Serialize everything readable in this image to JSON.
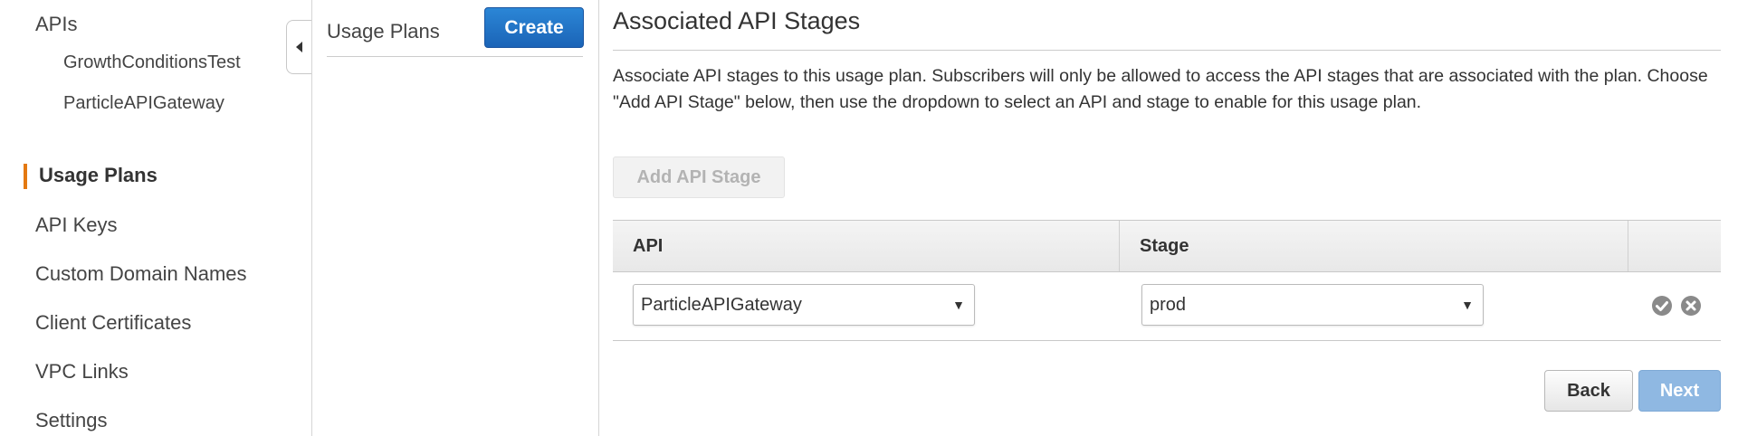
{
  "nav": {
    "apis": "APIs",
    "api_children": [
      "GrowthConditionsTest",
      "ParticleAPIGateway"
    ],
    "usage_plans": "Usage Plans",
    "api_keys": "API Keys",
    "custom_domains": "Custom Domain Names",
    "client_certs": "Client Certificates",
    "vpc_links": "VPC Links",
    "settings": "Settings",
    "active_accent": "#e47911"
  },
  "mid": {
    "title": "Usage Plans",
    "create_label": "Create"
  },
  "main": {
    "title": "Associated API Stages",
    "description": "Associate API stages to this usage plan. Subscribers will only be allowed to access the API stages that are associated with the plan. Choose \"Add API Stage\" below, then use the dropdown to select an API and stage to enable for this usage plan.",
    "add_stage_label": "Add API Stage",
    "table": {
      "headers": [
        "API",
        "Stage",
        ""
      ],
      "row": {
        "api_value": "ParticleAPIGateway",
        "stage_value": "prod",
        "caret": "▼"
      }
    },
    "back_label": "Back",
    "next_label": "Next"
  },
  "colors": {
    "primary_button": "#1b64b7",
    "disabled_next": "#8fb8e2"
  }
}
